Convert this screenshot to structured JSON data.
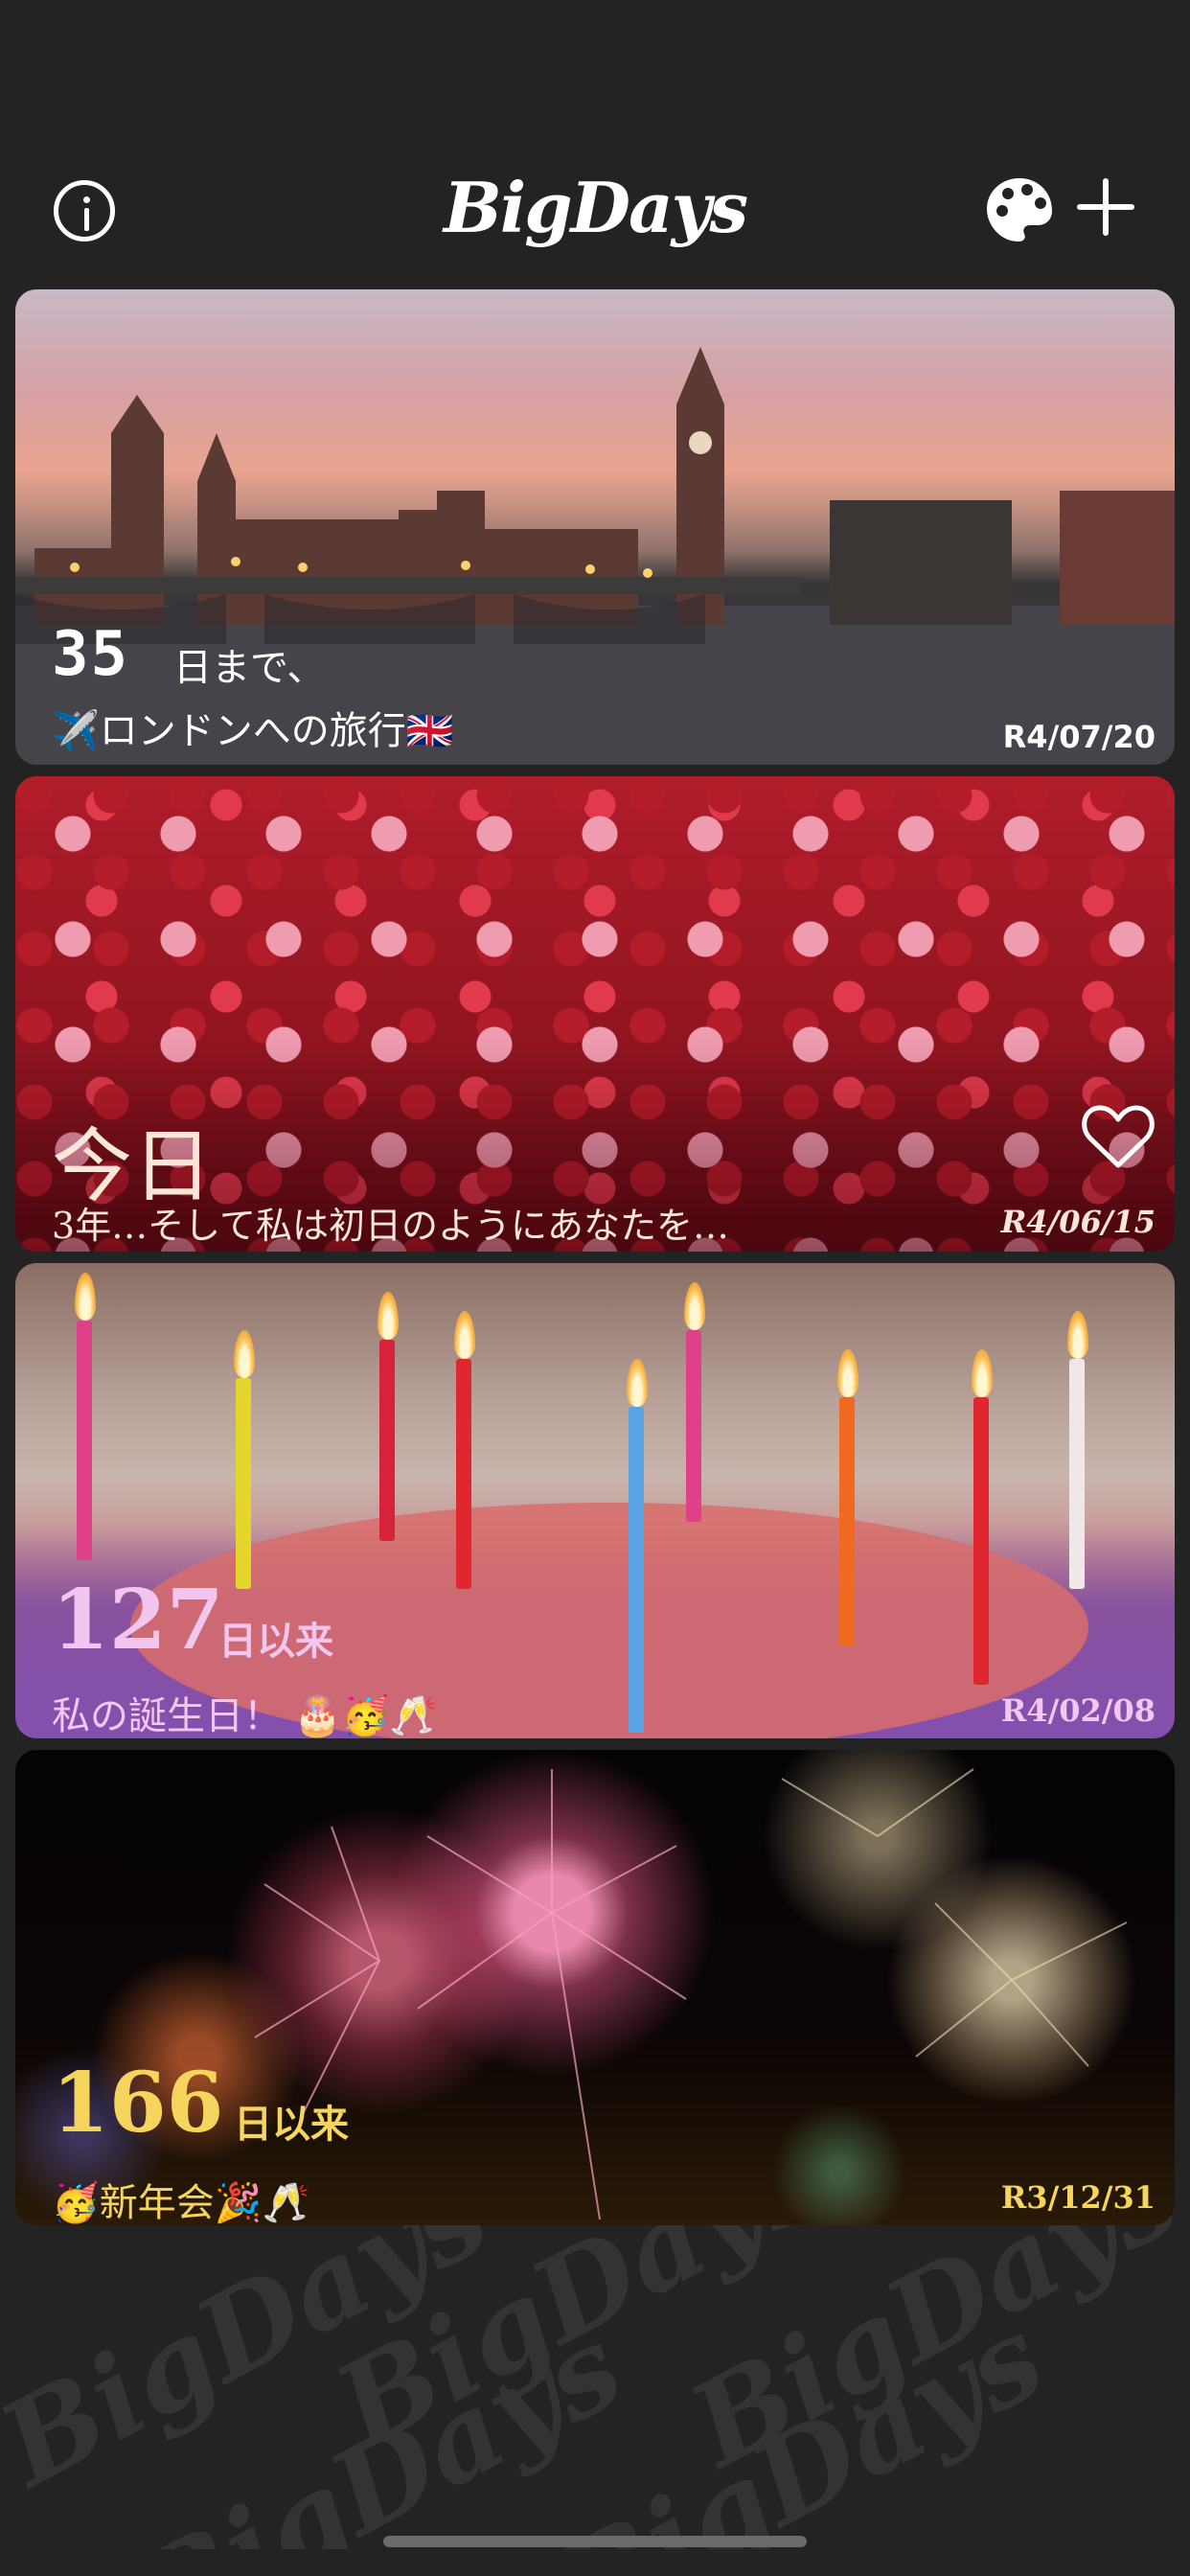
{
  "app": {
    "title": "BigDays"
  },
  "header": {
    "info_icon": "info-circle-icon",
    "palette_icon": "palette-icon",
    "add_icon": "plus-icon"
  },
  "cards": [
    {
      "count": "35",
      "unit": "日まで、",
      "title": "✈️ロンドンへの旅行🇬🇧",
      "date": "R4/07/20",
      "color": "#ffffff"
    },
    {
      "count": "今日",
      "unit": "",
      "title": "3年…そして私は初日のようにあなたを…",
      "date": "R4/06/15",
      "color": "#fbe7d7",
      "favorite_icon": "heart-outline-icon"
    },
    {
      "count": "127",
      "unit": "日以来",
      "title": "私の誕生日！ 🎂🥳🥂",
      "date": "R4/02/08",
      "color": "#f3c6f0"
    },
    {
      "count": "166",
      "unit": "日以来",
      "title": "🥳新年会🎉🥂",
      "date": "R3/12/31",
      "color": "#f6d55e"
    }
  ],
  "watermark_text": "BigDays"
}
